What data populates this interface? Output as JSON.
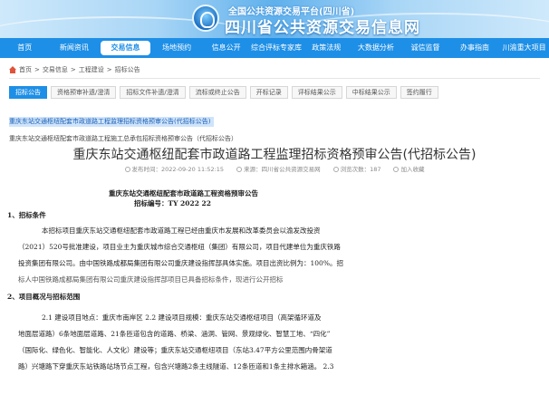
{
  "header": {
    "title_sub": "全国公共资源交易平台(四川省)",
    "title_main": "四川省公共资源交易信息网"
  },
  "nav": {
    "items": [
      {
        "label": "首页",
        "active": false
      },
      {
        "label": "新闻资讯",
        "active": false
      },
      {
        "label": "交易信息",
        "active": true
      },
      {
        "label": "场地预约",
        "active": false
      },
      {
        "label": "信息公开",
        "active": false
      },
      {
        "label": "综合评标专家库",
        "active": false
      },
      {
        "label": "政策法规",
        "active": false
      },
      {
        "label": "大数据分析",
        "active": false
      },
      {
        "label": "诚信监督",
        "active": false
      },
      {
        "label": "办事指南",
        "active": false
      },
      {
        "label": "川渝重大项目",
        "active": false
      }
    ]
  },
  "breadcrumb": [
    "首页",
    "交易信息",
    "工程建设",
    "招标公告"
  ],
  "tabs": [
    {
      "label": "招标公告",
      "active": true
    },
    {
      "label": "资格预审补遗/澄清",
      "active": false
    },
    {
      "label": "招标文件补遗/澄清",
      "active": false
    },
    {
      "label": "流标或终止公告",
      "active": false
    },
    {
      "label": "开标记录",
      "active": false
    },
    {
      "label": "评标结果公示",
      "active": false
    },
    {
      "label": "中标结果公示",
      "active": false
    },
    {
      "label": "签约履行",
      "active": false
    }
  ],
  "related": [
    "重庆东站交通枢纽配套市政道路工程监理招标资格预审公告(代招标公告)",
    "重庆东站交通枢纽配套市政道路工程施工总承包招标资格预审公告（代招标公告）"
  ],
  "article": {
    "title": "重庆东站交通枢纽配套市政道路工程监理招标资格预审公告(代招标公告)",
    "meta": {
      "time": "发布时间：2022-09-20 11:52:15",
      "source": "来源：四川省公共资源交易网",
      "views": "浏览次数：187",
      "favorite": "加入收藏"
    }
  },
  "document": {
    "heading": "重庆东站交通枢纽配套市政道路工程资格预审公告",
    "number": "招标编号：TY 2022 22",
    "sec1": "1、招标条件",
    "p1": [
      "本招标项目重庆东站交通枢纽配套市政道路工程已经由重庆市发展和改革委员会以渝发改投资",
      "（2021）520号批准建设，项目业主为重庆城市综合交通枢纽（集团）有限公司，项目代建单位为重庆铁路",
      "投资集团有限公司。由中国铁路成都局集团有限公司重庆建设指挥部具体实施。项目出资比例为：100%。招",
      "标人中国铁路成都局集团有限公司重庆建设指挥部项目已具备招标条件，现进行公开招标"
    ],
    "sec2": "2、项目概况与招标范围",
    "p2": [
      "2.1 建设项目地点：重庆市南岸区 2.2 建设项目规模：重庆东站交通枢纽项目（高架循环道及",
      "地面层道路）6条地面层道路、21条匝道包含的道路、桥梁、涵洞、管网、景观绿化、智慧工地、“四化”",
      "（国际化、绿色化、智能化、人文化）建设等；重庆东站交通枢纽项目（东站3.47平方公里范围内骨架道",
      "路）兴塘路下穿重庆东站铁路站场节点工程，包含兴塘路2条主线隧道、12条匝道和1条主排水箱涵。 2.3"
    ]
  }
}
